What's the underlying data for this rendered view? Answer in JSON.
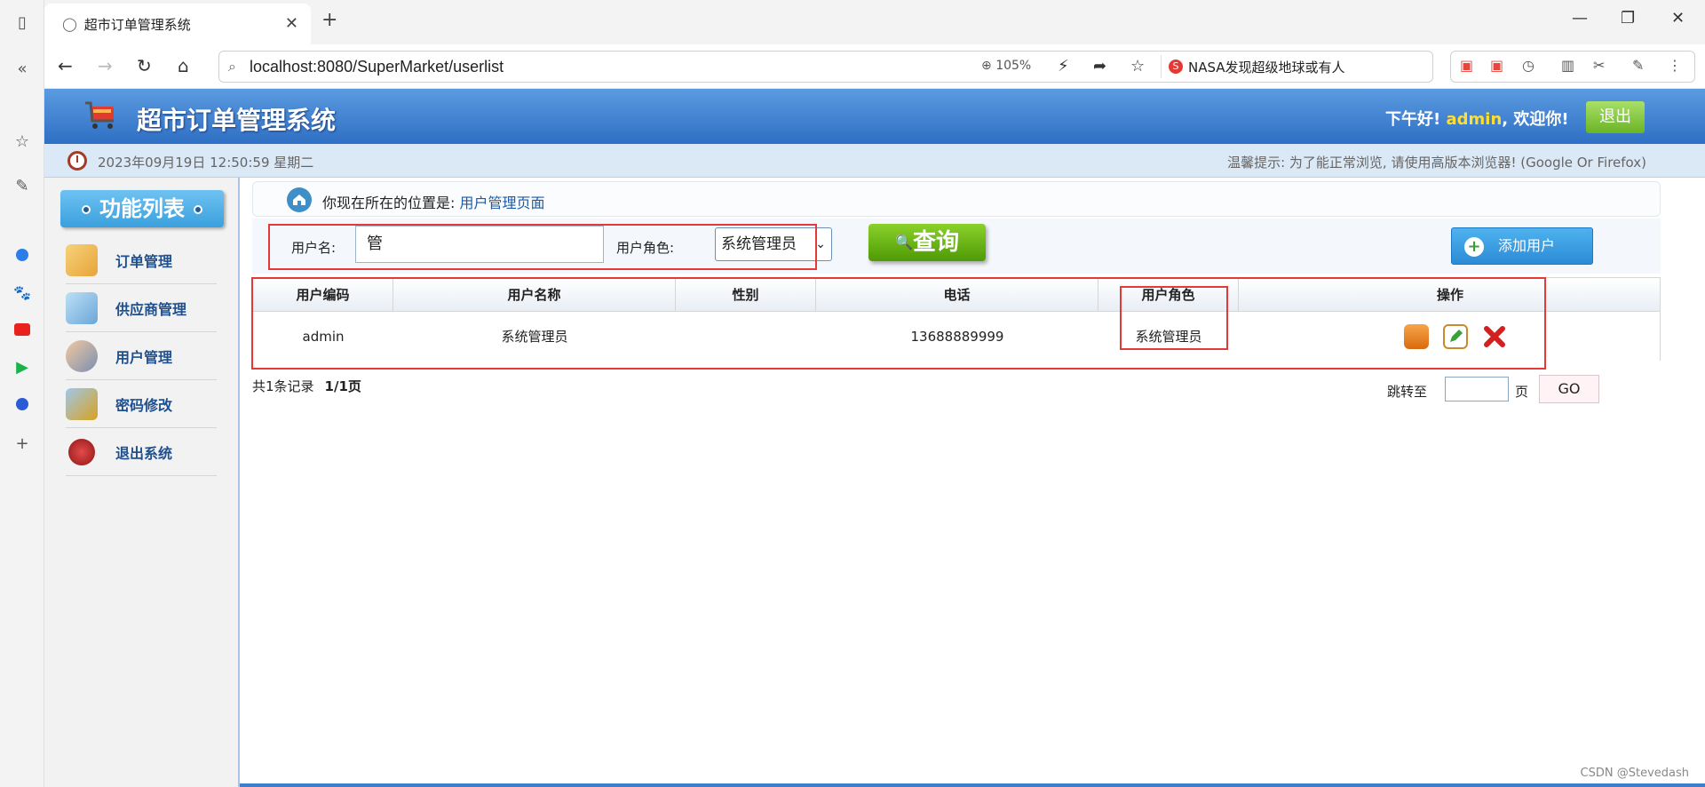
{
  "browser": {
    "tab_title": "超市订单管理系统",
    "url": "localhost:8080/SuperMarket/userlist",
    "zoom": "105%",
    "news_ticker": "NASA发现超级地球或有人",
    "new_tab_symbol": "+",
    "close_symbol": "✕"
  },
  "header": {
    "title": "超市订单管理系统",
    "greeting_prefix": "下午好!",
    "username": "admin",
    "greeting_suffix": ", 欢迎你!",
    "logout_label": "退出"
  },
  "infobar": {
    "datetime": "2023年09月19日 12:50:59 星期二",
    "tip": "温馨提示: 为了能正常浏览, 请使用高版本浏览器! (Google Or Firefox)"
  },
  "sidebar": {
    "title": "功能列表",
    "items": [
      {
        "label": "订单管理",
        "icon": "order-icon",
        "color": "#e8a33a"
      },
      {
        "label": "供应商管理",
        "icon": "supplier-icon",
        "color": "#6aa6d8"
      },
      {
        "label": "用户管理",
        "icon": "users-icon",
        "color": "#7a8fb0"
      },
      {
        "label": "密码修改",
        "icon": "password-icon",
        "color": "#d9a11f"
      },
      {
        "label": "退出系统",
        "icon": "exit-icon",
        "color": "#b52323"
      }
    ]
  },
  "location": {
    "prefix": "你现在所在的位置是:",
    "page": "用户管理页面"
  },
  "search": {
    "username_label": "用户名:",
    "username_value": "管",
    "role_label": "用户角色:",
    "role_value": "系统管理员",
    "query_label": "查询",
    "add_user_label": "添加用户"
  },
  "table": {
    "headers": [
      "用户编码",
      "用户名称",
      "性别",
      "电话",
      "用户角色",
      "操作"
    ],
    "rows": [
      {
        "code": "admin",
        "name": "系统管理员",
        "gender": "",
        "phone": "13688889999",
        "role": "系统管理员"
      }
    ]
  },
  "pager": {
    "total": "共1条记录",
    "pages": "1/1页",
    "jump_label": "跳转至",
    "page_unit": "页",
    "go_label": "GO"
  },
  "watermark": "CSDN @Stevedash",
  "colors": {
    "header_blue": "#2f6fc4",
    "accent_green": "#6bb324",
    "highlight_red": "#e53935",
    "username_yellow": "#ffdd33"
  }
}
